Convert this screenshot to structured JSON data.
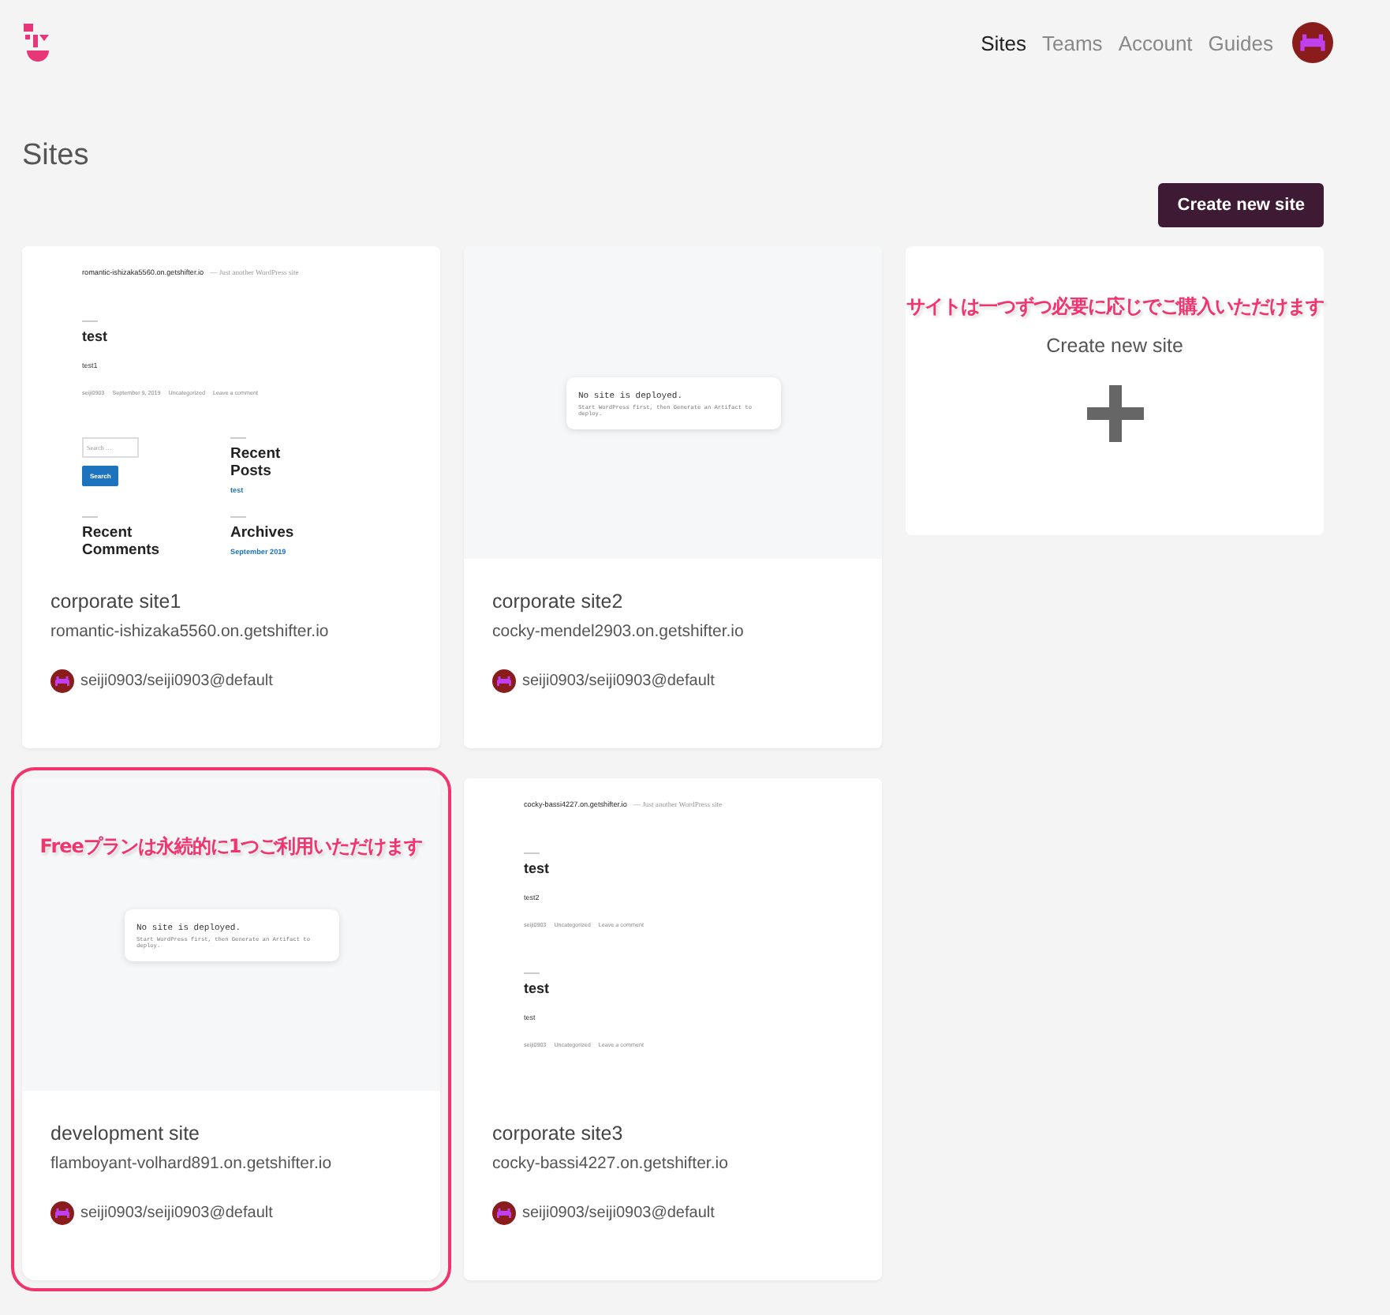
{
  "header": {
    "nav": [
      {
        "label": "Sites",
        "selected": true
      },
      {
        "label": "Teams",
        "selected": false
      },
      {
        "label": "Account",
        "selected": false
      },
      {
        "label": "Guides",
        "selected": false
      }
    ]
  },
  "page_title": "Sites",
  "create_button": "Create new site",
  "cards": [
    {
      "kind": "site",
      "name": "corporate site1",
      "domain": "romantic-ishizaka5560.on.getshifter.io",
      "owner": "seiji0903/seiji0903@default",
      "highlighted": false,
      "preview": {
        "kind": "wordpress",
        "site_title": "romantic-ishizaka5560.on.getshifter.io",
        "tagline": "— Just another WordPress site",
        "posts": [
          {
            "title": "test",
            "body": "test1",
            "meta": [
              "seiji0903",
              "September 9, 2019",
              "Uncategorized",
              "Leave a comment"
            ]
          }
        ],
        "widgets": {
          "search_placeholder": "Search …",
          "search_button": "Search",
          "sections": [
            {
              "title": "Recent Posts",
              "links": [
                "test"
              ]
            },
            {
              "title": "Recent Comments"
            },
            {
              "title": "Archives",
              "links": [
                "September 2019"
              ]
            }
          ]
        }
      }
    },
    {
      "kind": "site",
      "name": "corporate site2",
      "domain": "cocky-mendel2903.on.getshifter.io",
      "owner": "seiji0903/seiji0903@default",
      "highlighted": false,
      "preview": {
        "kind": "empty",
        "heading": "No site is deployed.",
        "message": "Start WordPress first, then Generate an Artifact to deploy."
      }
    },
    {
      "kind": "new",
      "label": "Create new site",
      "annotation": "サイトは一つずつ必要に応じでご購入いただけます"
    },
    {
      "kind": "site",
      "name": "development site",
      "domain": "flamboyant-volhard891.on.getshifter.io",
      "owner": "seiji0903/seiji0903@default",
      "highlighted": true,
      "annotation": "Freeプランは永続的に1つご利用いただけます",
      "preview": {
        "kind": "empty",
        "heading": "No site is deployed.",
        "message": "Start WordPress first, then Generate an Artifact to deploy."
      }
    },
    {
      "kind": "site",
      "name": "corporate site3",
      "domain": "cocky-bassi4227.on.getshifter.io",
      "owner": "seiji0903/seiji0903@default",
      "highlighted": false,
      "preview": {
        "kind": "wordpress",
        "site_title": "cocky-bassi4227.on.getshifter.io",
        "tagline": "— Just another WordPress site",
        "posts": [
          {
            "title": "test",
            "body": "test2",
            "meta": [
              "seiji0903",
              "Uncategorized",
              "Leave a comment"
            ]
          },
          {
            "title": "test",
            "body": "test",
            "meta": [
              "seiji0903",
              "Uncategorized",
              "Leave a comment"
            ]
          }
        ]
      }
    }
  ]
}
